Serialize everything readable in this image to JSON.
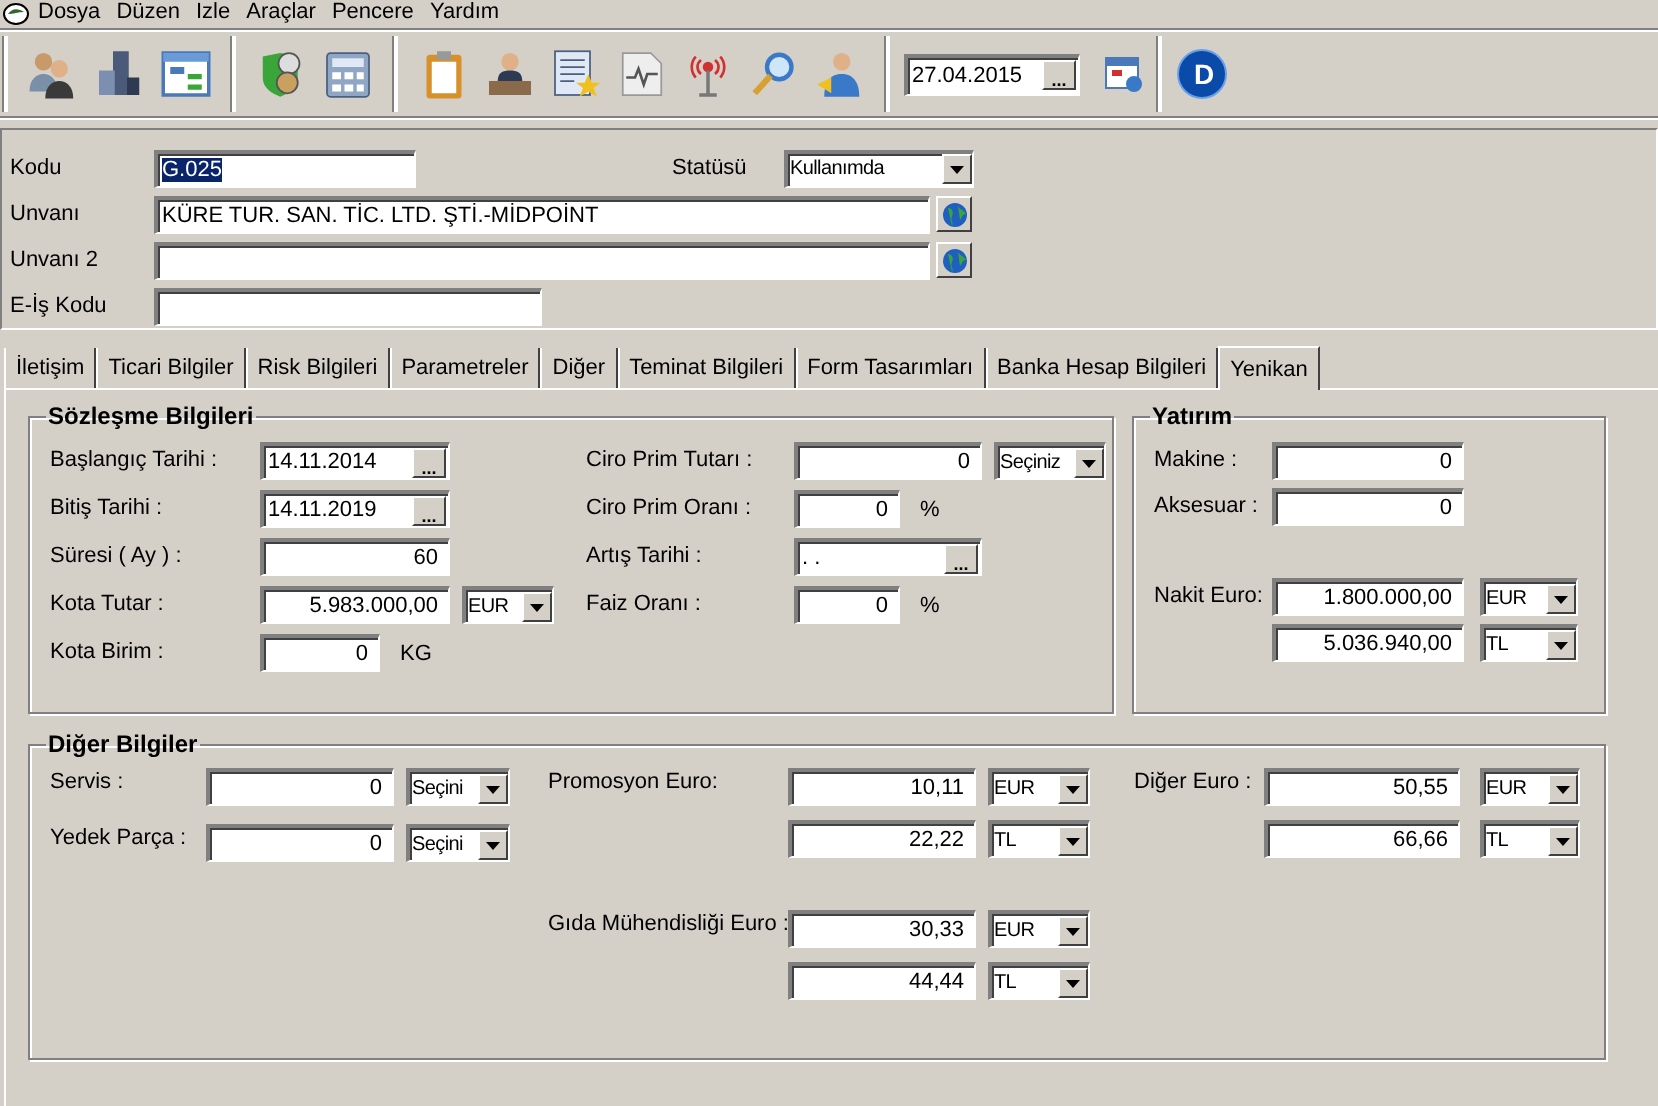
{
  "menu": [
    "Dosya",
    "Düzen",
    "Izle",
    "Araçlar",
    "Pencere",
    "Yardım"
  ],
  "toolbar": {
    "date": {
      "value": "27.04.2015",
      "button": "..."
    },
    "badge": "D"
  },
  "header": {
    "code": {
      "label": "Kodu",
      "value": "G.025",
      "highlighted": true
    },
    "status": {
      "label": "Statüsü",
      "value": "Kullanımda"
    },
    "title": {
      "label": "Unvanı",
      "value": "KÜRE TUR. SAN. TİC. LTD. ŞTİ.-MİDPOİNT"
    },
    "title2": {
      "label": "Unvanı 2"
    },
    "e_code": {
      "label": "E-İş Kodu"
    }
  },
  "tabs": [
    {
      "label": "İletişim",
      "selected": false
    },
    {
      "label": "Ticari Bilgiler",
      "selected": false
    },
    {
      "label": "Risk Bilgileri",
      "selected": false
    },
    {
      "label": "Parametreler",
      "selected": false
    },
    {
      "label": "Diğer",
      "selected": false
    },
    {
      "label": "Teminat Bilgileri",
      "selected": false
    },
    {
      "label": "Form Tasarımları",
      "selected": false
    },
    {
      "label": "Banka Hesap Bilgileri",
      "selected": false
    },
    {
      "label": "Yenikan",
      "selected": true
    }
  ],
  "groups": [
    {
      "kind": "contract",
      "title": "Sözleşme Bilgileri",
      "columns": [
        [
          {
            "items": [
              {
                "label": "Başlangıç Tarihi :",
                "lines": [
                  {
                    "kind": "date",
                    "value": "14.11.2014",
                    "button": "..."
                  }
                ]
              },
              {
                "label": "Bitiş Tarihi :",
                "lines": [
                  {
                    "kind": "date",
                    "value": "14.11.2019",
                    "button": "..."
                  }
                ]
              },
              {
                "label": "Süresi ( Ay ) :",
                "lines": [
                  {
                    "kind": "amount",
                    "value": "60"
                  }
                ]
              },
              {
                "label": "Kota Tutar :",
                "lines": [
                  {
                    "kind": "amount",
                    "value": "5.983.000,00",
                    "select": "EUR"
                  }
                ]
              },
              {
                "label": "Kota Birim :",
                "lines": [
                  {
                    "kind": "amount",
                    "value": "0",
                    "unit": "KG"
                  }
                ]
              }
            ]
          }
        ],
        [
          {
            "items": [
              {
                "label": "Ciro Prim Tutarı :",
                "lines": [
                  {
                    "kind": "amount",
                    "value": "0",
                    "select": "Seçiniz"
                  }
                ]
              },
              {
                "label": "Ciro Prim Oranı :",
                "lines": [
                  {
                    "kind": "amount",
                    "value": "0",
                    "unit": "%"
                  }
                ]
              },
              {
                "label": "Artış Tarihi :",
                "lines": [
                  {
                    "kind": "date",
                    "value": ". .",
                    "button": "..."
                  }
                ]
              },
              {
                "label": "Faiz Oranı :",
                "lines": [
                  {
                    "kind": "amount",
                    "value": "0",
                    "unit": "%"
                  }
                ]
              }
            ]
          }
        ]
      ]
    },
    {
      "kind": "investment",
      "title": "Yatırım",
      "columns": [
        [
          {
            "items": [
              {
                "label": "Makine :",
                "lines": [
                  {
                    "kind": "amount",
                    "value": "0"
                  }
                ]
              },
              {
                "label": "Aksesuar :",
                "lines": [
                  {
                    "kind": "amount",
                    "value": "0"
                  }
                ]
              }
            ]
          },
          {
            "items": [
              {
                "label": "Nakit Euro:",
                "lines": [
                  {
                    "kind": "amount",
                    "value": "1.800.000,00",
                    "select": "EUR"
                  },
                  {
                    "kind": "amount",
                    "value": "5.036.940,00",
                    "select": "TL"
                  }
                ]
              }
            ]
          }
        ]
      ]
    },
    {
      "kind": "other",
      "title": "Diğer Bilgiler",
      "columns": [
        [
          {
            "items": [
              {
                "label": "Servis :",
                "lines": [
                  {
                    "kind": "amount",
                    "value": "0",
                    "select": "Seçini"
                  }
                ]
              },
              {
                "label": "Yedek Parça :",
                "lines": [
                  {
                    "kind": "amount",
                    "value": "0",
                    "select": "Seçini"
                  }
                ]
              }
            ]
          }
        ],
        [
          {
            "items": [
              {
                "label": "Promosyon Euro:",
                "lines": [
                  {
                    "kind": "amount",
                    "value": "10,11",
                    "select": "EUR"
                  },
                  {
                    "kind": "amount",
                    "value": "22,22",
                    "select": "TL"
                  }
                ]
              }
            ]
          },
          {
            "items": [
              {
                "label": "Gıda Mühendisliği Euro :",
                "lines": [
                  {
                    "kind": "amount",
                    "value": "30,33",
                    "select": "EUR"
                  },
                  {
                    "kind": "amount",
                    "value": "44,44",
                    "select": "TL"
                  }
                ]
              }
            ]
          }
        ],
        [
          {
            "items": [
              {
                "label": "Diğer Euro :",
                "lines": [
                  {
                    "kind": "amount",
                    "value": "50,55",
                    "select": "EUR"
                  },
                  {
                    "kind": "amount",
                    "value": "66,66",
                    "select": "TL"
                  }
                ]
              }
            ]
          }
        ]
      ]
    }
  ]
}
